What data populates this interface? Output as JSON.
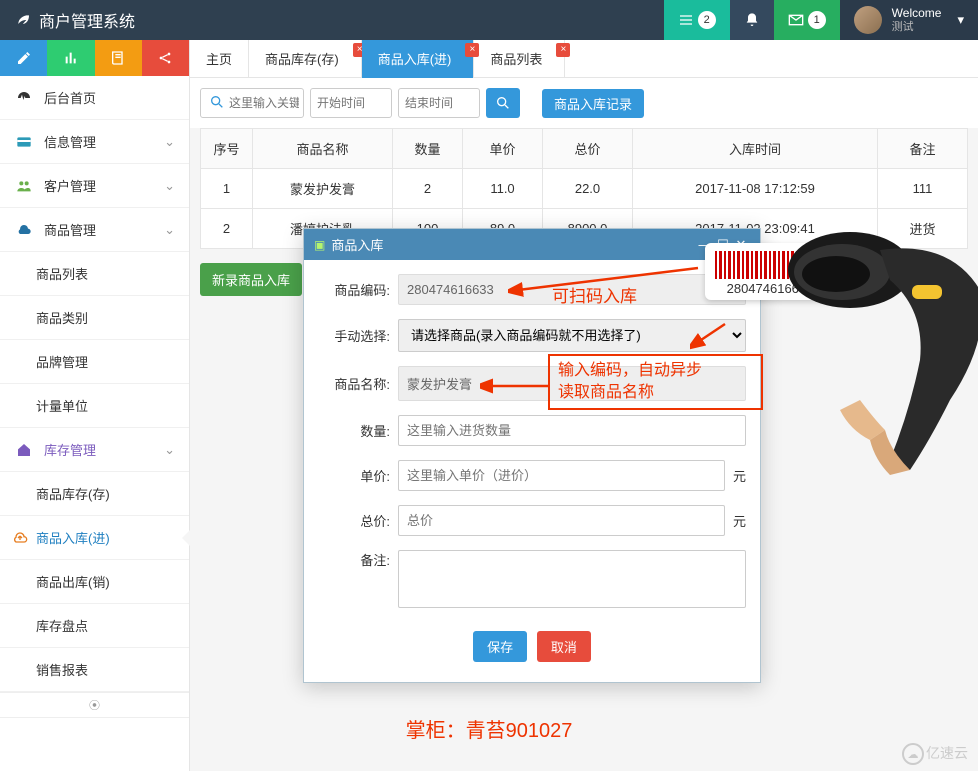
{
  "header": {
    "brand": "商户管理系统",
    "badge1": "2",
    "badge2": "1",
    "welcome": "Welcome",
    "user": "测试"
  },
  "sidebar": {
    "items": [
      {
        "icon": "dashboard-icon",
        "label": "后台首页"
      },
      {
        "icon": "card-icon",
        "label": "信息管理",
        "expandable": true
      },
      {
        "icon": "users-icon",
        "label": "客户管理",
        "expandable": true
      },
      {
        "icon": "cloud-icon",
        "label": "商品管理",
        "expandable": true
      }
    ],
    "product_children": [
      "商品列表",
      "商品类别",
      "品牌管理",
      "计量单位"
    ],
    "stock_parent": "库存管理",
    "stock_children": [
      "商品库存(存)",
      "商品入库(进)",
      "商品出库(销)",
      "库存盘点",
      "销售报表"
    ],
    "active_sub_index": 1
  },
  "tabs": [
    {
      "label": "主页"
    },
    {
      "label": "商品库存(存)",
      "closable": true
    },
    {
      "label": "商品入库(进)",
      "closable": true,
      "active": true
    },
    {
      "label": "商品列表",
      "closable": true
    }
  ],
  "filter": {
    "search_placeholder": "这里输入关键",
    "start_placeholder": "开始时间",
    "end_placeholder": "结束时间",
    "records_link": "商品入库记录"
  },
  "table": {
    "headers": [
      "序号",
      "商品名称",
      "数量",
      "单价",
      "总价",
      "入库时间",
      "备注"
    ],
    "rows": [
      [
        "1",
        "蒙发护发膏",
        "2",
        "11.0",
        "22.0",
        "2017-11-08 17:12:59",
        "111"
      ],
      [
        "2",
        "潘婷护法乳",
        "100",
        "89.0",
        "8900.0",
        "2017-11-02 23:09:41",
        "进货"
      ]
    ]
  },
  "new_button": "新录商品入库",
  "dialog": {
    "title": "商品入库",
    "labels": {
      "code": "商品编码:",
      "manual": "手动选择:",
      "name": "商品名称:",
      "qty": "数量:",
      "price": "单价:",
      "total": "总价:",
      "note": "备注:"
    },
    "values": {
      "code": "280474616633",
      "manual_placeholder": "请选择商品(录入商品编码就不用选择了)",
      "name": "蒙发护发膏",
      "qty_placeholder": "这里输入进货数量",
      "price_placeholder": "这里输入单价（进价）",
      "total_placeholder": "总价",
      "unit": "元"
    },
    "buttons": {
      "save": "保存",
      "cancel": "取消"
    }
  },
  "annotations": {
    "scan_text": "可扫码入库",
    "auto_text_line1": "输入编码，自动异步",
    "auto_text_line2": "读取商品名称",
    "barcode_num": "280474616633",
    "footer": "掌柜：青苔901027",
    "watermark": "亿速云"
  }
}
